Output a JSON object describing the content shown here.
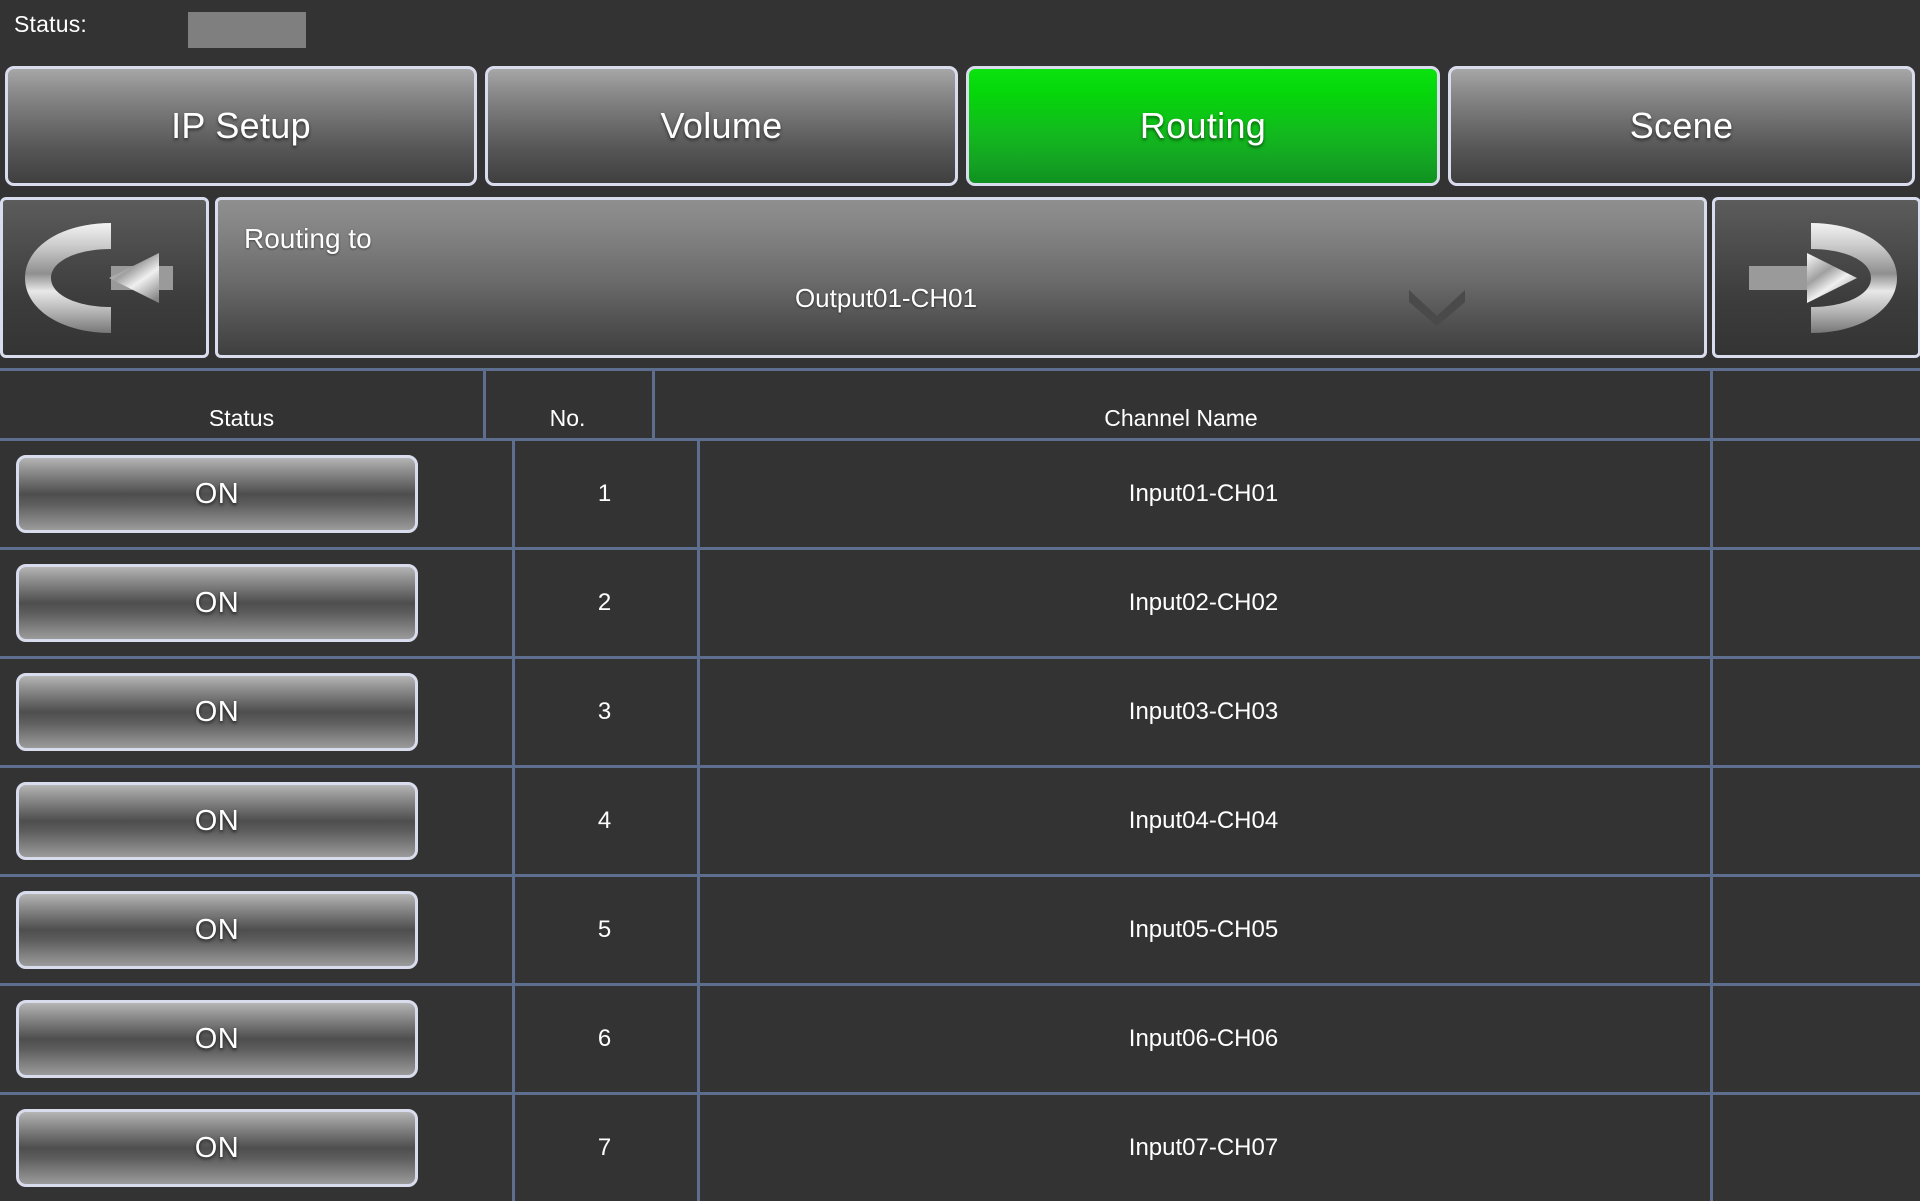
{
  "statusbar": {
    "label": "Status:",
    "value": ""
  },
  "tabs": [
    {
      "label": "IP Setup",
      "active": false
    },
    {
      "label": "Volume",
      "active": false
    },
    {
      "label": "Routing",
      "active": true
    },
    {
      "label": "Scene",
      "active": false
    }
  ],
  "routing": {
    "prev_icon": "route-in-left-arrow-icon",
    "next_icon": "route-out-right-arrow-icon",
    "to_label": "Routing to",
    "selected": "Output01-CH01",
    "chevron_icon": "chevron-down-icon"
  },
  "table": {
    "headers": {
      "status": "Status",
      "no": "No.",
      "name": "Channel Name"
    },
    "rows": [
      {
        "status": "ON",
        "no": "1",
        "name": "Input01-CH01"
      },
      {
        "status": "ON",
        "no": "2",
        "name": "Input02-CH02"
      },
      {
        "status": "ON",
        "no": "3",
        "name": "Input03-CH03"
      },
      {
        "status": "ON",
        "no": "4",
        "name": "Input04-CH04"
      },
      {
        "status": "ON",
        "no": "5",
        "name": "Input05-CH05"
      },
      {
        "status": "ON",
        "no": "6",
        "name": "Input06-CH06"
      },
      {
        "status": "ON",
        "no": "7",
        "name": "Input07-CH07"
      }
    ]
  },
  "colors": {
    "background": "#333333",
    "active_tab_green": "#0ad60f",
    "grid_line": "#5e6e8e",
    "button_border": "#d9dced",
    "status_box": "#7f7f7f"
  }
}
